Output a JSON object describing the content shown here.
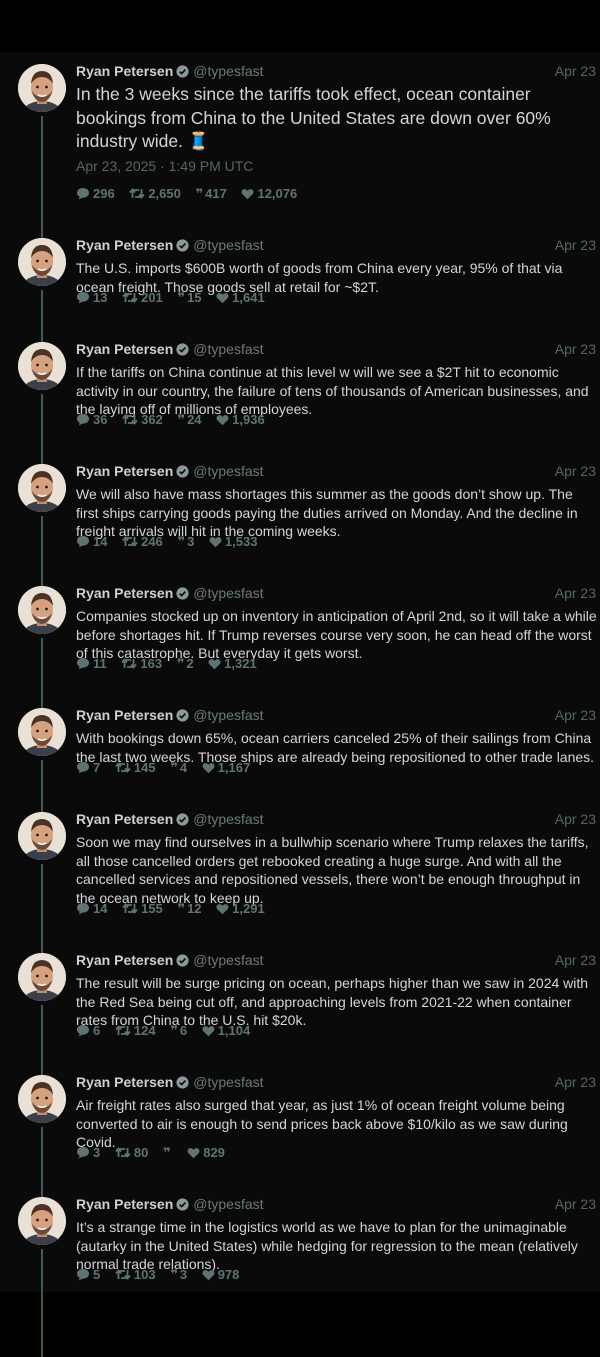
{
  "author": {
    "name": "Ryan Petersen",
    "handle": "@typesfast"
  },
  "colors": {
    "background": "#0a0a0a",
    "muted": "#5e7474",
    "thread_line": "#3e5a55"
  },
  "tweets": [
    {
      "date": "Apr 23",
      "text": "In the 3 weeks since the tariffs took effect, ocean container bookings from China to the United States are down over 60% industry wide. 🧵",
      "timestamp": "Apr 23, 2025 · 1:49 PM UTC",
      "replies": "296",
      "retweets": "2,650",
      "quotes": "417",
      "likes": "12,076"
    },
    {
      "date": "Apr 23",
      "text": "The U.S. imports $600B worth of goods from China every year, 95% of that via ocean freight. Those goods sell at retail for ~$2T.",
      "replies": "13",
      "retweets": "201",
      "quotes": "15",
      "likes": "1,641"
    },
    {
      "date": "Apr 23",
      "text": "If the tariffs on China continue at this level w will we see a $2T hit to economic activity in our country, the failure of tens of thousands of American businesses, and the laying off of millions of employees.",
      "replies": "36",
      "retweets": "362",
      "quotes": "24",
      "likes": "1,936"
    },
    {
      "date": "Apr 23",
      "text": "We will also have mass shortages this summer as the goods don’t show up. The first ships carrying goods paying the duties arrived on Monday. And the decline in freight arrivals will hit in the coming weeks.",
      "replies": "14",
      "retweets": "246",
      "quotes": "3",
      "likes": "1,533"
    },
    {
      "date": "Apr 23",
      "text": "Companies stocked up on inventory in anticipation of April 2nd, so it will take a while before shortages hit. If Trump reverses course very soon, he can head off the worst of this catastrophe. But everyday it gets worst.",
      "replies": "11",
      "retweets": "163",
      "quotes": "2",
      "likes": "1,321"
    },
    {
      "date": "Apr 23",
      "text": "With bookings down 65%, ocean carriers canceled 25% of their sailings from China the last two weeks. Those ships are already being repositioned to other trade lanes.",
      "replies": "7",
      "retweets": "145",
      "quotes": "4",
      "likes": "1,167"
    },
    {
      "date": "Apr 23",
      "text": "Soon we may find ourselves in a bullwhip scenario where Trump relaxes the tariffs, all those cancelled orders get rebooked creating a huge surge. And with all the cancelled services and repositioned vessels, there won’t be enough throughput in the ocean network to keep up.",
      "replies": "14",
      "retweets": "155",
      "quotes": "12",
      "likes": "1,291"
    },
    {
      "date": "Apr 23",
      "text": "The result will be surge pricing on ocean, perhaps higher than we saw in 2024 with the Red Sea being cut off, and approaching levels from 2021-22 when container rates from China to the U.S. hit $20k.",
      "replies": "6",
      "retweets": "124",
      "quotes": "6",
      "likes": "1,104"
    },
    {
      "date": "Apr 23",
      "text": "Air freight rates also surged that year, as just 1% of ocean freight volume being converted to air is enough to send prices back above $10/kilo as we saw during Covid.",
      "replies": "3",
      "retweets": "80",
      "quotes": "",
      "likes": "829"
    },
    {
      "date": "Apr 23",
      "text": "It’s a strange time in the logistics world as we have to plan for the unimaginable (autarky in the United States) while hedging for regression to the mean (relatively normal trade relations).",
      "replies": "5",
      "retweets": "103",
      "quotes": "3",
      "likes": "978"
    }
  ],
  "icons": {
    "reply": "comment-icon",
    "retweet": "retweet-icon",
    "quote": "quote-icon",
    "like": "heart-icon",
    "verified": "verified-badge-icon"
  }
}
